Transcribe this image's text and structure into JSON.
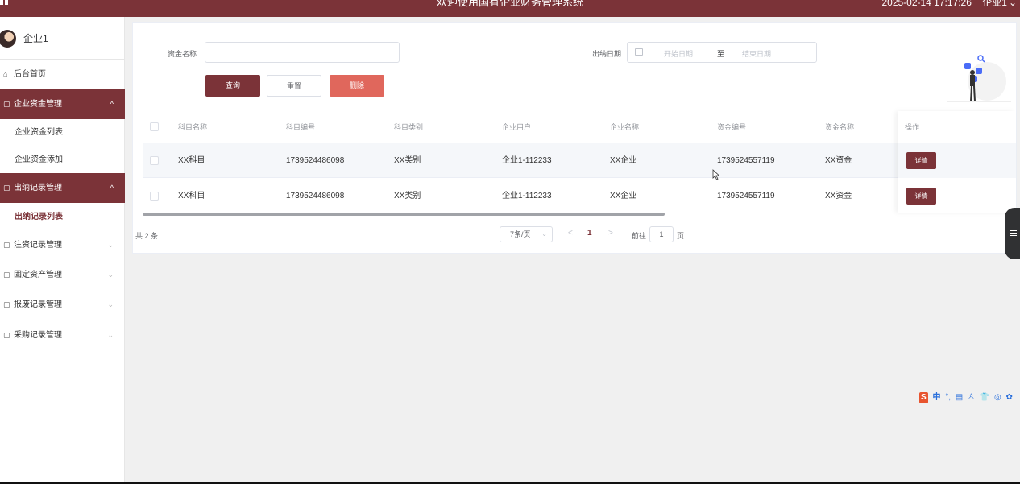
{
  "header": {
    "title": "欢迎使用国有企业财务管理系统",
    "datetime": "2025-02-14 17:17:26",
    "user_menu": "企业1"
  },
  "sidebar": {
    "username": "企业1",
    "home": "后台首页",
    "groups": [
      {
        "label": "企业资金管理",
        "expanded": true,
        "children": [
          "企业资金列表",
          "企业资金添加"
        ]
      },
      {
        "label": "出纳记录管理",
        "expanded": true,
        "children": [
          "出纳记录列表"
        ]
      },
      {
        "label": "注资记录管理",
        "expanded": false
      },
      {
        "label": "固定资产管理",
        "expanded": false
      },
      {
        "label": "报废记录管理",
        "expanded": false
      },
      {
        "label": "采购记录管理",
        "expanded": false
      }
    ]
  },
  "search": {
    "fund_name_label": "资金名称",
    "fund_name_value": "",
    "date_label": "出纳日期",
    "start_placeholder": "开始日期",
    "range_sep": "至",
    "end_placeholder": "结束日期",
    "query_label": "查询",
    "reset_label": "重置",
    "delete_label": "删除"
  },
  "table": {
    "columns": [
      "科目名称",
      "科目编号",
      "科目类别",
      "企业用户",
      "企业名称",
      "资金编号",
      "资金名称",
      "操作"
    ],
    "rows": [
      [
        "XX科目",
        "1739524486098",
        "XX类别",
        "企业1-112233",
        "XX企业",
        "1739524557119",
        "XX资金"
      ],
      [
        "XX科目",
        "1739524486098",
        "XX类别",
        "企业1-112233",
        "XX企业",
        "1739524557119",
        "XX资金"
      ]
    ],
    "detail_label": "详情"
  },
  "pagination": {
    "total": "共 2 条",
    "page_size": "7条/页",
    "prev": "<",
    "current_page": "1",
    "next": ">",
    "goto_label": "前往",
    "goto_value": "1",
    "page_unit": "页"
  },
  "ime_bar": [
    "中",
    "°,",
    "▤",
    "♙",
    "👕",
    "◎",
    "✿"
  ],
  "colors": {
    "primary": "#7b3338",
    "danger": "#e0675c"
  }
}
